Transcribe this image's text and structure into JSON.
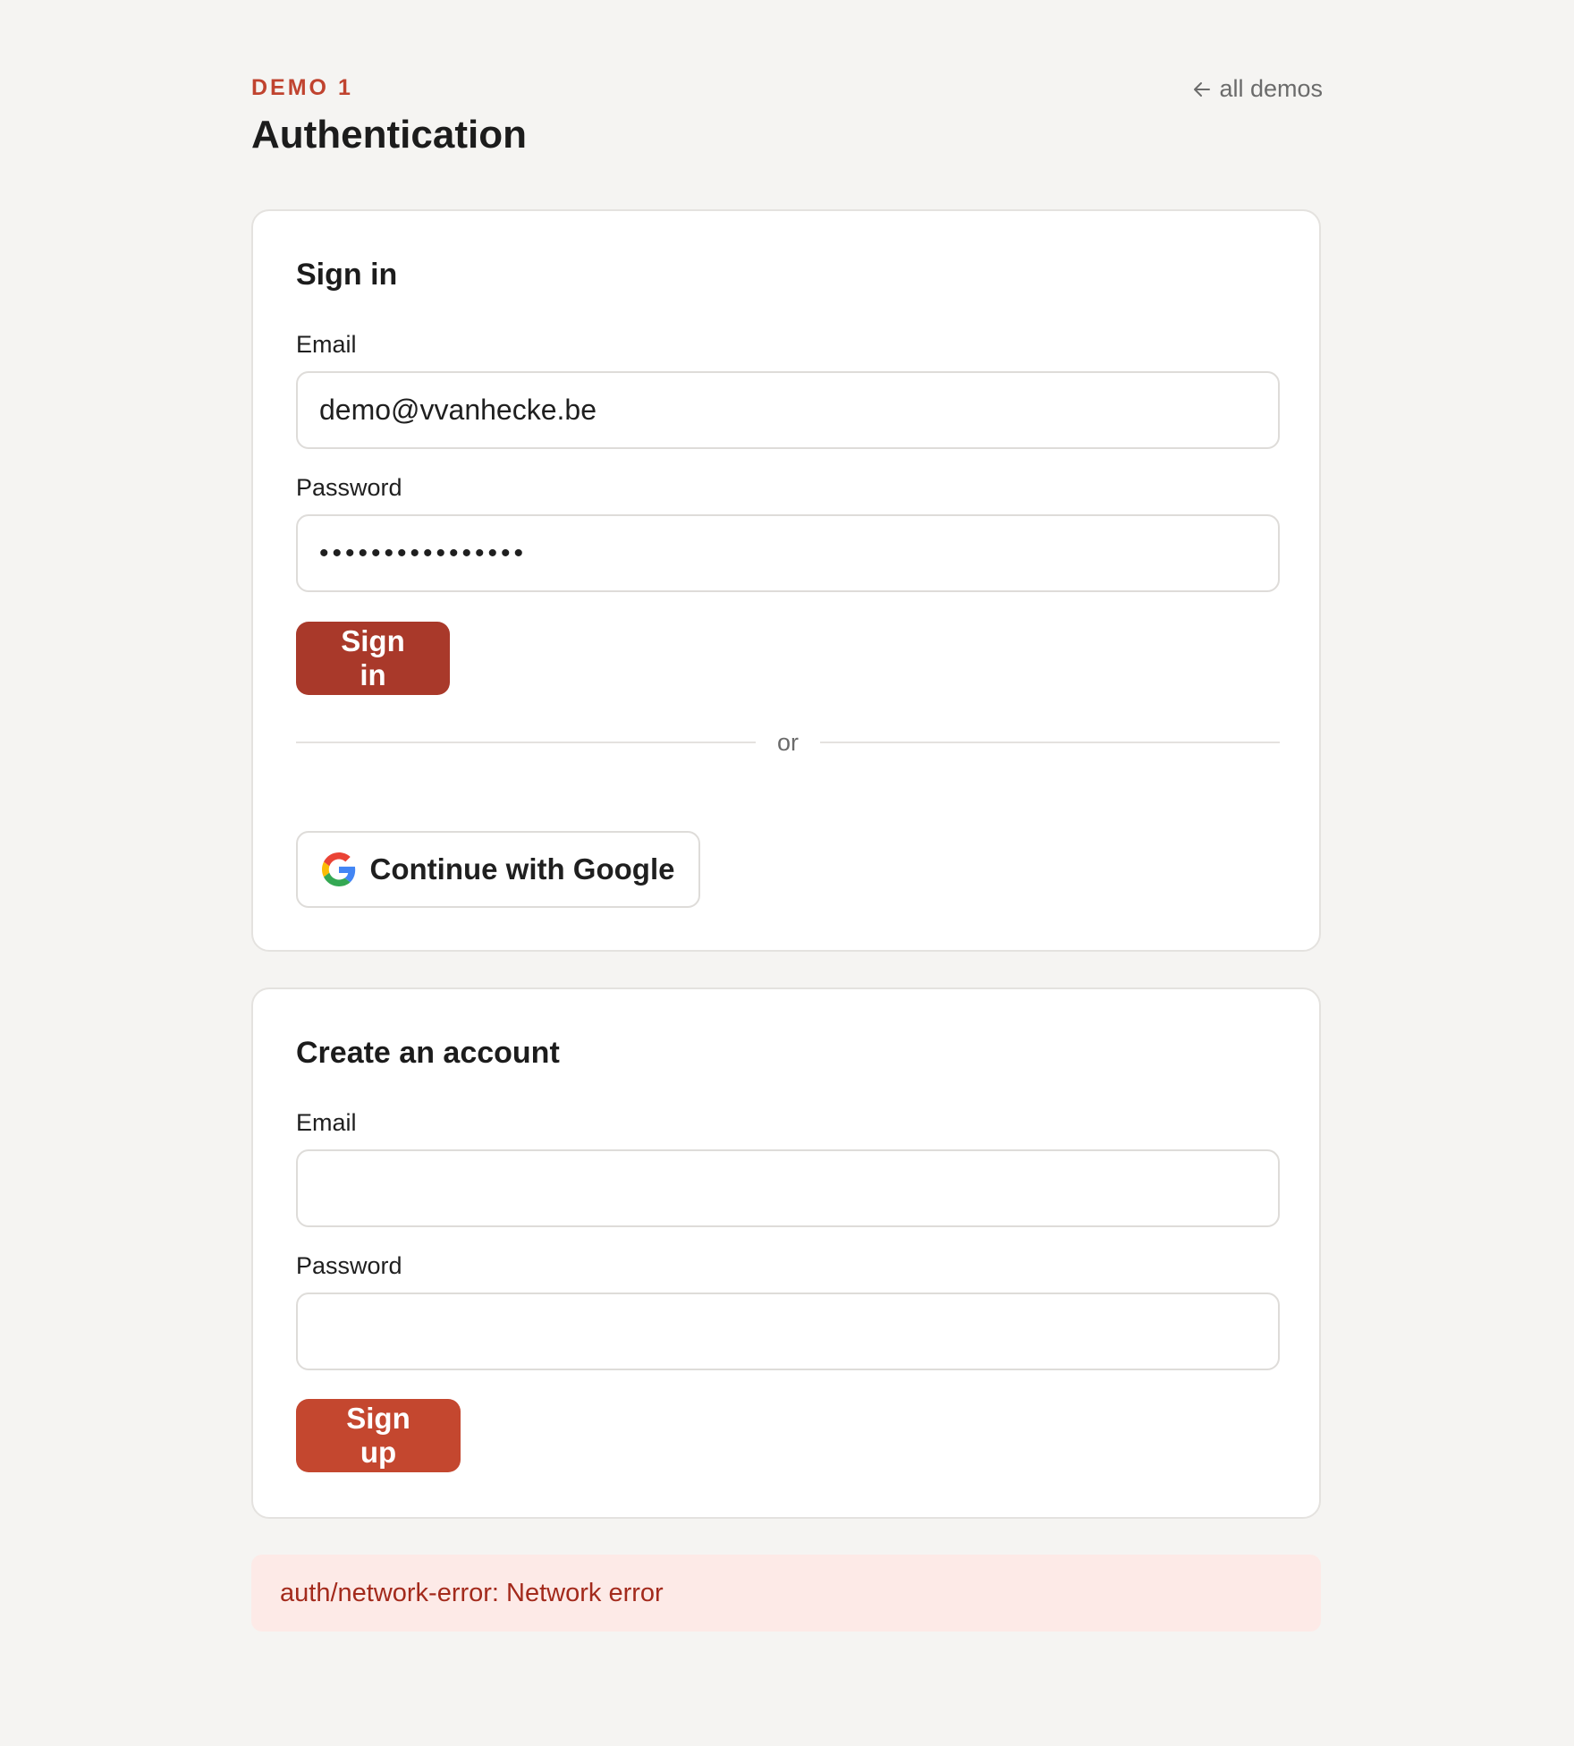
{
  "header": {
    "eyebrow": "DEMO 1",
    "title": "Authentication",
    "back_link_label": "all demos"
  },
  "signin": {
    "title": "Sign in",
    "email_label": "Email",
    "email_value": "demo@vvanhecke.be",
    "password_label": "Password",
    "password_value": "••••••••••••••••",
    "button_label": "Sign in",
    "divider_label": "or",
    "google_button_label": "Continue with Google"
  },
  "signup": {
    "title": "Create an account",
    "email_label": "Email",
    "email_value": "",
    "password_label": "Password",
    "password_value": "",
    "button_label": "Sign up"
  },
  "error": {
    "message": "auth/network-error: Network error"
  },
  "colors": {
    "accent": "#c0432f",
    "signin_button": "#a9392a",
    "signup_button": "#c4472f",
    "error_bg": "#fdeae7",
    "error_text": "#a32a1c",
    "background": "#f5f4f2"
  }
}
